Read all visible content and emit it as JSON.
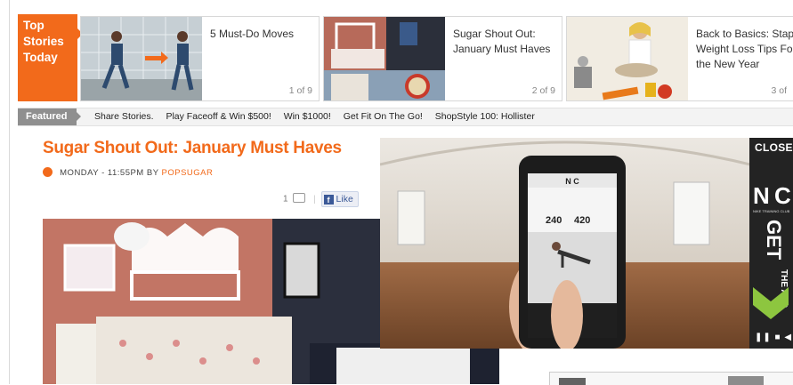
{
  "top_stories": {
    "label_lines": [
      "Top",
      "Stories",
      "Today"
    ],
    "items": [
      {
        "title": "5 Must-Do Moves",
        "count": "1 of 9"
      },
      {
        "title": "Sugar Shout Out: January Must Haves",
        "count": "2 of 9"
      },
      {
        "title": "Back to Basics: Staple Weight Loss Tips For the New Year",
        "count": "3 of"
      }
    ]
  },
  "featured": {
    "label": "Featured",
    "links": [
      "Share Stories.",
      "Play Faceoff & Win $500!",
      "Win $1000!",
      "Get Fit On The Go!",
      "ShopStyle 100: Hollister"
    ]
  },
  "article": {
    "title": "Sugar Shout Out: January Must Haves",
    "date": "MONDAY - 11:55PM",
    "by": "BY",
    "author": "POPSUGAR",
    "comment_count": "1",
    "like_label": "Like"
  },
  "video": {
    "app_brand": "N C",
    "stat_calories": "240",
    "stat_minutes": "420"
  },
  "ad": {
    "close_label": "CLOSE X",
    "logo": "N C",
    "tagline": "NIKE TRAINING CLUB",
    "get_label": "GET",
    "app_label": "THE APP"
  },
  "colors": {
    "brand_orange": "#f26a1b",
    "facebook_blue": "#3b5998"
  }
}
